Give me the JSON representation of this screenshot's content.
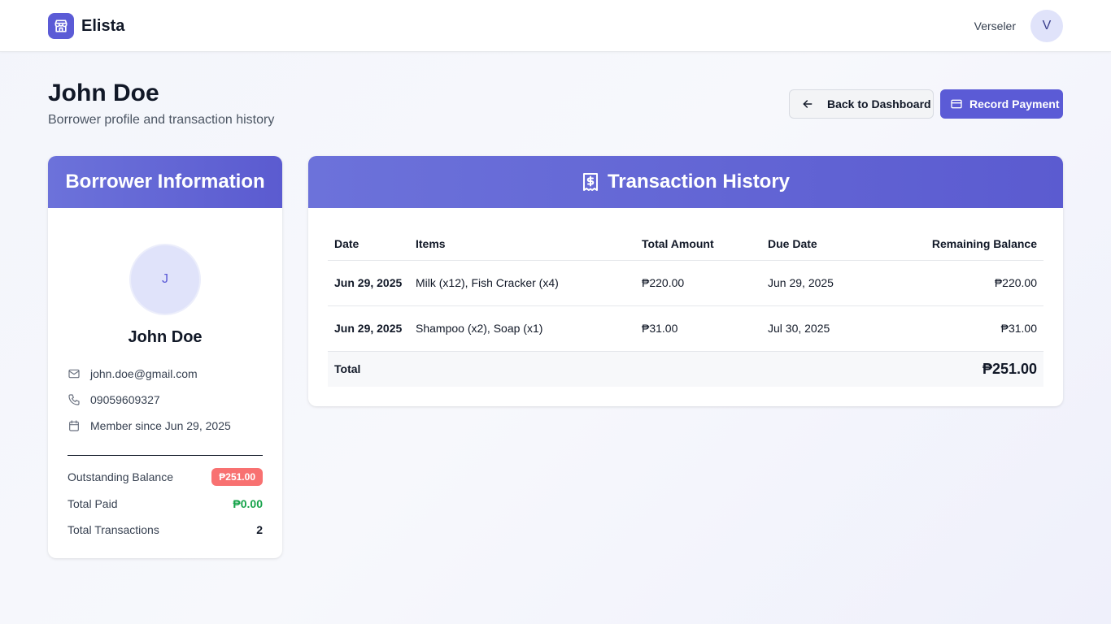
{
  "app": {
    "name": "Elista",
    "icon": "store-icon",
    "brand_color": "#5b5bd6"
  },
  "user": {
    "name": "Verseler",
    "initial": "V"
  },
  "page": {
    "title": "John Doe",
    "subtitle": "Borrower profile and transaction history"
  },
  "actions": {
    "back_label": "Back to Dashboard",
    "record_label": "Record Payment"
  },
  "borrower": {
    "card_title": "Borrower Information",
    "initial": "J",
    "name": "John Doe",
    "email": "john.doe@gmail.com",
    "phone": "09059609327",
    "member_since": "Member since Jun 29, 2025",
    "stats": {
      "outstanding_label": "Outstanding Balance",
      "outstanding_value": "₱251.00",
      "paid_label": "Total Paid",
      "paid_value": "₱0.00",
      "transactions_label": "Total Transactions",
      "transactions_value": "2"
    }
  },
  "transactions": {
    "card_title": "Transaction History",
    "columns": {
      "date": "Date",
      "items": "Items",
      "total_amount": "Total Amount",
      "due_date": "Due Date",
      "remaining_balance": "Remaining Balance"
    },
    "rows": [
      {
        "date": "Jun 29, 2025",
        "items": "Milk (x12), Fish Cracker (x4)",
        "total_amount": "₱220.00",
        "due_date": "Jun 29, 2025",
        "remaining_balance": "₱220.00"
      },
      {
        "date": "Jun 29, 2025",
        "items": "Shampoo (x2), Soap (x1)",
        "total_amount": "₱31.00",
        "due_date": "Jul 30, 2025",
        "remaining_balance": "₱31.00"
      }
    ],
    "total_label": "Total",
    "total_value": "₱251.00"
  },
  "colors": {
    "accent": "#5b5bd6",
    "danger": "#f87171",
    "success": "#16a34a"
  }
}
